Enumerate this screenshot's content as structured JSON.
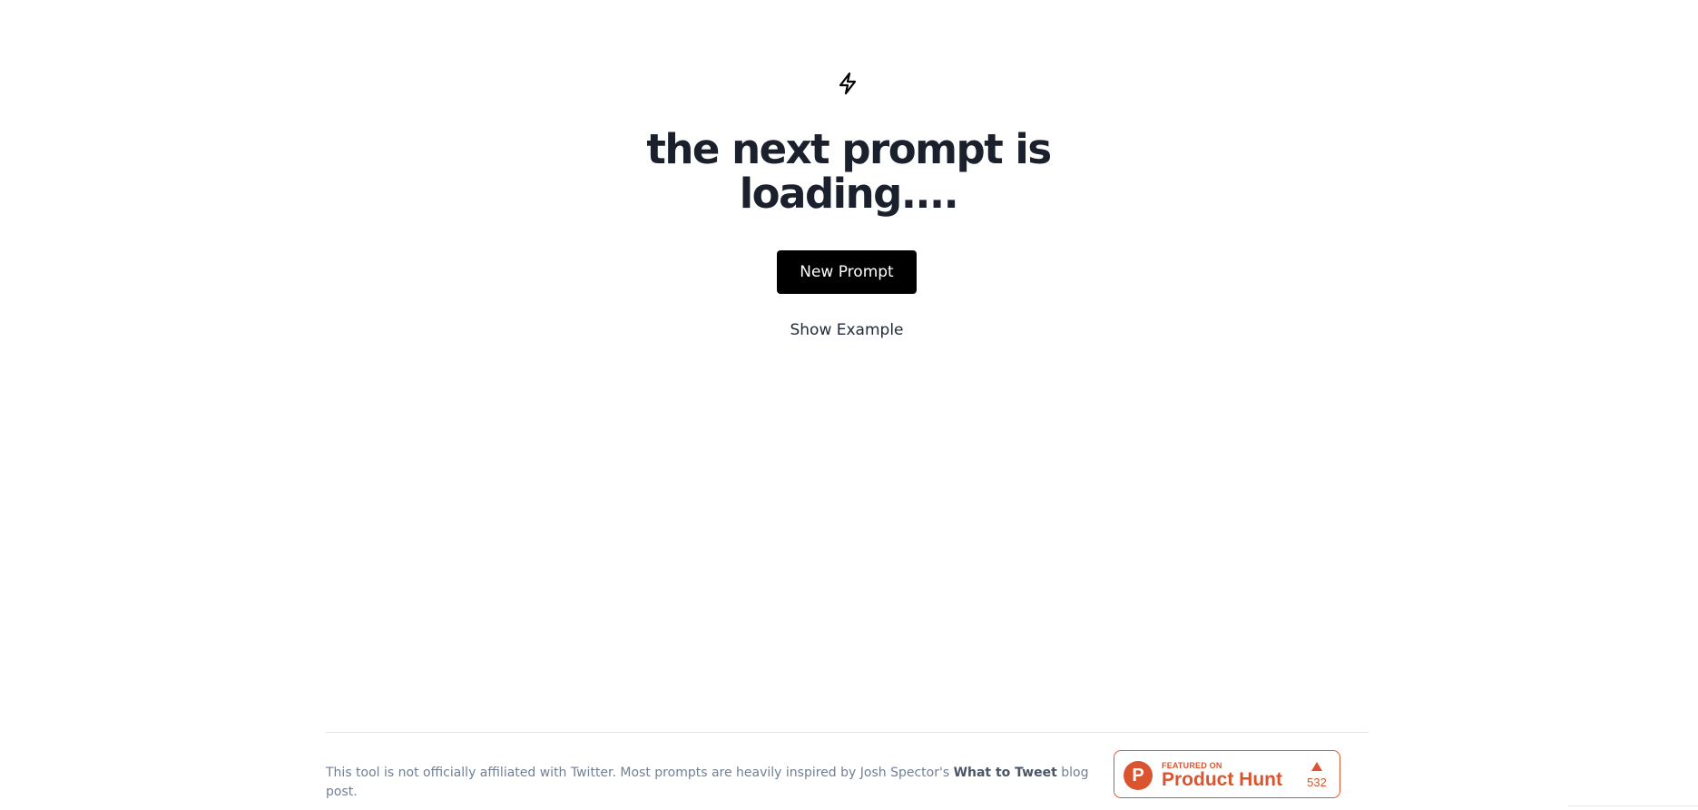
{
  "hero": {
    "icon": "bolt-icon",
    "headline": "the next prompt is loading....",
    "new_prompt_label": "New Prompt",
    "show_example_label": "Show Example"
  },
  "footer": {
    "disclaimer_before": "This tool is not officially affiliated with Twitter. Most prompts are heavily inspired by Josh Spector's ",
    "link_label": "What to Tweet",
    "disclaimer_after": " blog post."
  },
  "product_hunt": {
    "logo_letter": "P",
    "featured_label": "FEATURED ON",
    "name": "Product Hunt",
    "upvotes": "532",
    "color": "#da552f"
  },
  "colors": {
    "headline": "#1a202c",
    "button_bg": "#000000",
    "footer_text": "#718096"
  }
}
